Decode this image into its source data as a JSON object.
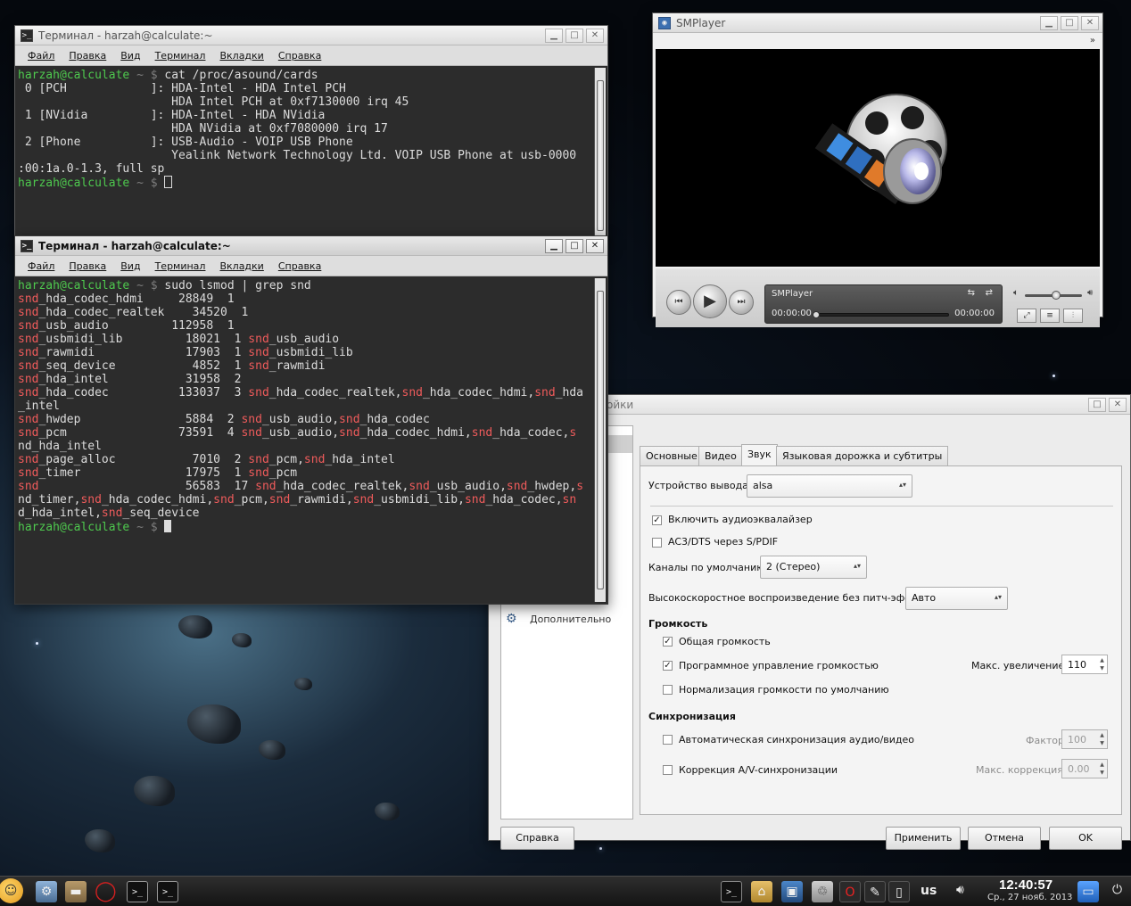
{
  "terminal1": {
    "title": "Терминал - harzah@calculate:~",
    "menu": [
      "Файл",
      "Правка",
      "Вид",
      "Терминал",
      "Вкладки",
      "Справка"
    ],
    "prompt_user": "harzah@calculate",
    "prompt_sym": "~ $",
    "command": "cat /proc/asound/cards",
    "output": [
      " 0 [PCH            ]: HDA-Intel - HDA Intel PCH",
      "                      HDA Intel PCH at 0xf7130000 irq 45",
      " 1 [NVidia         ]: HDA-Intel - HDA NVidia",
      "                      HDA NVidia at 0xf7080000 irq 17",
      " 2 [Phone          ]: USB-Audio - VOIP USB Phone",
      "                      Yealink Network Technology Ltd. VOIP USB Phone at usb-0000",
      ":00:1a.0-1.3, full sp"
    ]
  },
  "terminal2": {
    "title": "Терминал - harzah@calculate:~",
    "menu": [
      "Файл",
      "Правка",
      "Вид",
      "Терминал",
      "Вкладки",
      "Справка"
    ],
    "prompt_user": "harzah@calculate",
    "prompt_sym": "~ $",
    "command": "sudo lsmod | grep snd",
    "rows": [
      [
        [
          "r",
          "snd"
        ],
        [
          "w",
          "_hda_codec_hdmi     28849  1"
        ]
      ],
      [
        [
          "r",
          "snd"
        ],
        [
          "w",
          "_hda_codec_realtek    34520  1"
        ]
      ],
      [
        [
          "r",
          "snd"
        ],
        [
          "w",
          "_usb_audio         112958  1"
        ]
      ],
      [
        [
          "r",
          "snd"
        ],
        [
          "w",
          "_usbmidi_lib         18021  1 "
        ],
        [
          "r",
          "snd"
        ],
        [
          "w",
          "_usb_audio"
        ]
      ],
      [
        [
          "r",
          "snd"
        ],
        [
          "w",
          "_rawmidi             17903  1 "
        ],
        [
          "r",
          "snd"
        ],
        [
          "w",
          "_usbmidi_lib"
        ]
      ],
      [
        [
          "r",
          "snd"
        ],
        [
          "w",
          "_seq_device           4852  1 "
        ],
        [
          "r",
          "snd"
        ],
        [
          "w",
          "_rawmidi"
        ]
      ],
      [
        [
          "r",
          "snd"
        ],
        [
          "w",
          "_hda_intel           31958  2"
        ]
      ],
      [
        [
          "r",
          "snd"
        ],
        [
          "w",
          "_hda_codec          133037  3 "
        ],
        [
          "r",
          "snd"
        ],
        [
          "w",
          "_hda_codec_realtek,"
        ],
        [
          "r",
          "snd"
        ],
        [
          "w",
          "_hda_codec_hdmi,"
        ],
        [
          "r",
          "snd"
        ],
        [
          "w",
          "_hda"
        ]
      ],
      [
        [
          "w",
          "_intel"
        ]
      ],
      [
        [
          "r",
          "snd"
        ],
        [
          "w",
          "_hwdep               5884  2 "
        ],
        [
          "r",
          "snd"
        ],
        [
          "w",
          "_usb_audio,"
        ],
        [
          "r",
          "snd"
        ],
        [
          "w",
          "_hda_codec"
        ]
      ],
      [
        [
          "r",
          "snd"
        ],
        [
          "w",
          "_pcm                73591  4 "
        ],
        [
          "r",
          "snd"
        ],
        [
          "w",
          "_usb_audio,"
        ],
        [
          "r",
          "snd"
        ],
        [
          "w",
          "_hda_codec_hdmi,"
        ],
        [
          "r",
          "snd"
        ],
        [
          "w",
          "_hda_codec,"
        ],
        [
          "r",
          "s"
        ]
      ],
      [
        [
          "w",
          "nd_hda_intel"
        ]
      ],
      [
        [
          "r",
          "snd"
        ],
        [
          "w",
          "_page_alloc           7010  2 "
        ],
        [
          "r",
          "snd"
        ],
        [
          "w",
          "_pcm,"
        ],
        [
          "r",
          "snd"
        ],
        [
          "w",
          "_hda_intel"
        ]
      ],
      [
        [
          "r",
          "snd"
        ],
        [
          "w",
          "_timer               17975  1 "
        ],
        [
          "r",
          "snd"
        ],
        [
          "w",
          "_pcm"
        ]
      ],
      [
        [
          "r",
          "snd"
        ],
        [
          "w",
          "                     56583  17 "
        ],
        [
          "r",
          "snd"
        ],
        [
          "w",
          "_hda_codec_realtek,"
        ],
        [
          "r",
          "snd"
        ],
        [
          "w",
          "_usb_audio,"
        ],
        [
          "r",
          "snd"
        ],
        [
          "w",
          "_hwdep,"
        ],
        [
          "r",
          "s"
        ]
      ],
      [
        [
          "w",
          "nd_timer,"
        ],
        [
          "r",
          "snd"
        ],
        [
          "w",
          "_hda_codec_hdmi,"
        ],
        [
          "r",
          "snd"
        ],
        [
          "w",
          "_pcm,"
        ],
        [
          "r",
          "snd"
        ],
        [
          "w",
          "_rawmidi,"
        ],
        [
          "r",
          "snd"
        ],
        [
          "w",
          "_usbmidi_lib,"
        ],
        [
          "r",
          "snd"
        ],
        [
          "w",
          "_hda_codec,"
        ],
        [
          "r",
          "sn"
        ]
      ],
      [
        [
          "w",
          "d_hda_intel,"
        ],
        [
          "r",
          "snd"
        ],
        [
          "w",
          "_seq_device"
        ]
      ]
    ]
  },
  "smplayer": {
    "title": "SMPlayer",
    "overflow": "»",
    "display_title": "SMPlayer",
    "time_current": "00:00:00",
    "time_total": "00:00:00",
    "progress": 0,
    "volume": 0.55
  },
  "prefs": {
    "title_fragment": "ойки",
    "sidebar_item": "Дополнительно",
    "tabs": [
      "Основные",
      "Видео",
      "Звук",
      "Языковая дорожка и субтитры"
    ],
    "selected_tab": "Звук",
    "output_device_label": "Устройство вывода:",
    "output_device_value": "alsa",
    "eq_label": "Включить аудиоэквалайзер",
    "eq_checked": true,
    "spdif_label": "AC3/DTS через S/PDIF",
    "spdif_checked": false,
    "channels_label": "Каналы по умолчанию:",
    "channels_value": "2 (Стерео)",
    "pitch_label": "Высокоскоростное воспроизведение без питч-эффекта",
    "pitch_value": "Авто",
    "volume_header": "Громкость",
    "global_volume_label": "Общая громкость",
    "global_volume_checked": true,
    "soft_volume_label": "Программное управление громкостью",
    "soft_volume_checked": true,
    "max_amp_label": "Макс. увеличение:",
    "max_amp_value": "110",
    "normalize_label": "Нормализация громкости по умолчанию",
    "normalize_checked": false,
    "sync_header": "Синхронизация",
    "autosync_label": "Автоматическая синхронизация аудио/видео",
    "autosync_checked": false,
    "factor_label": "Фактор:",
    "factor_value": "100",
    "avcorr_label": "Коррекция A/V-синхронизации",
    "avcorr_checked": false,
    "maxcorr_label": "Макс. коррекция:",
    "maxcorr_value": "0.00",
    "help_button": "Справка",
    "apply_button": "Применить",
    "cancel_button": "Отмена",
    "ok_button": "OK"
  },
  "taskbar": {
    "keyboard_layout": "us",
    "time": "12:40:57",
    "date": "Ср., 27 нояб. 2013"
  },
  "colors": {
    "prompt_green": "#4ec94e",
    "module_red": "#ef5b5b",
    "terminal_bg": "#2c2c2c"
  }
}
